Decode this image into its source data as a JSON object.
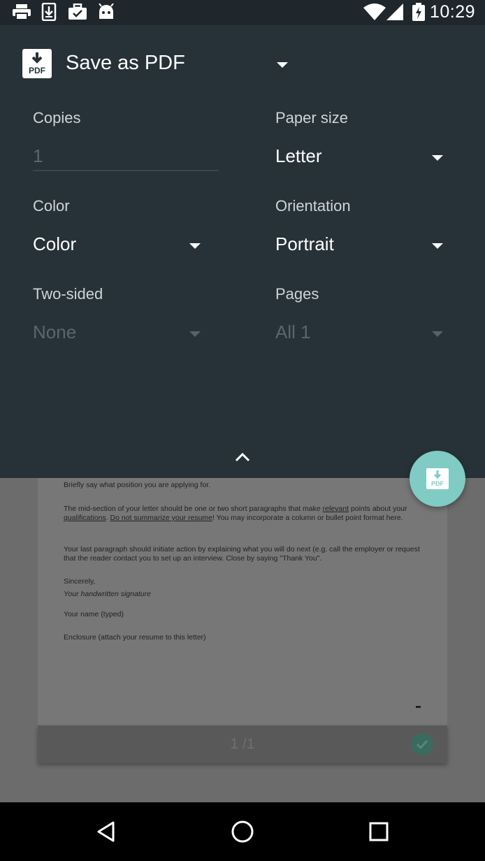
{
  "status_bar": {
    "time": "10:29",
    "left_icons": [
      "print-icon",
      "download-icon",
      "briefcase-icon",
      "android-icon"
    ],
    "right_icons": [
      "wifi-icon",
      "signal-icon",
      "battery-charging-icon"
    ]
  },
  "destination": {
    "label": "Save as PDF",
    "icon": "pdf-icon"
  },
  "options": {
    "copies": {
      "label": "Copies",
      "placeholder": "1"
    },
    "paper_size": {
      "label": "Paper size",
      "value": "Letter"
    },
    "color": {
      "label": "Color",
      "value": "Color"
    },
    "orientation": {
      "label": "Orientation",
      "value": "Portrait"
    },
    "two_sided": {
      "label": "Two-sided",
      "value": "None"
    },
    "pages": {
      "label": "Pages",
      "value": "All 1"
    }
  },
  "fab": {
    "label": "PDF"
  },
  "preview": {
    "line1": "Briefly say what position you are applying for.",
    "para2a": "The mid-section of your letter should be one or two short paragraphs that make",
    "para2_relevant": "relevant",
    "para2b": "points about your",
    "para2_qualifications": "qualifications",
    "para2_dont": "Do not summarize your resume",
    "para2c": "! You may incorporate a column or bullet point format here.",
    "para3": "Your last paragraph should initiate action by explaining what you will do next (e.g. call the employer or request that the reader contact you to set up an interview. Close by saying \"Thank You\".",
    "closing": "Sincerely,",
    "signature": "Your handwritten signature",
    "name": "Your name (typed)",
    "enclosure": "Enclosure (attach your resume to this letter)",
    "page_indicator": "1 /1"
  },
  "colors": {
    "panel": "#263238",
    "fab": "#80cbc4",
    "accent": "#3b6b5e"
  }
}
